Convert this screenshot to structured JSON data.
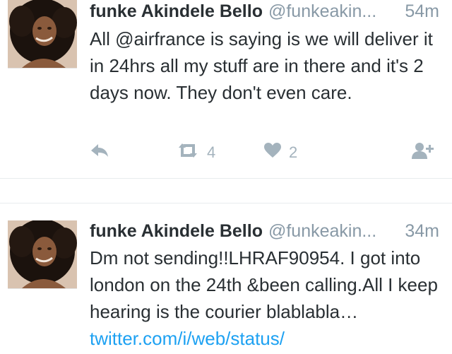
{
  "tweets": [
    {
      "author_name": "funke Akindele Bello",
      "author_handle": "@funkeakin...",
      "time": "54m",
      "text": "All @airfrance is saying is we will deliver it in 24hrs all my stuff are in there and it's 2 days now. They don't even care.",
      "retweet_count": "4",
      "like_count": "2",
      "icons": {
        "reply": "reply-icon",
        "retweet": "retweet-icon",
        "like": "heart-icon",
        "follow": "follow-icon"
      }
    },
    {
      "author_name": "funke Akindele Bello",
      "author_handle": "@funkeakin...",
      "time": "34m",
      "text": "Dm not sending!!LHRAF90954. I got into london on the 24th &been calling.All I keep hearing is the courier blablabla… ",
      "link": "twitter.com/i/web/status/"
    }
  ],
  "colors": {
    "text": "#292f33",
    "muted": "#8899a6",
    "icon": "#a4b3bd",
    "link": "#1da1f2"
  }
}
